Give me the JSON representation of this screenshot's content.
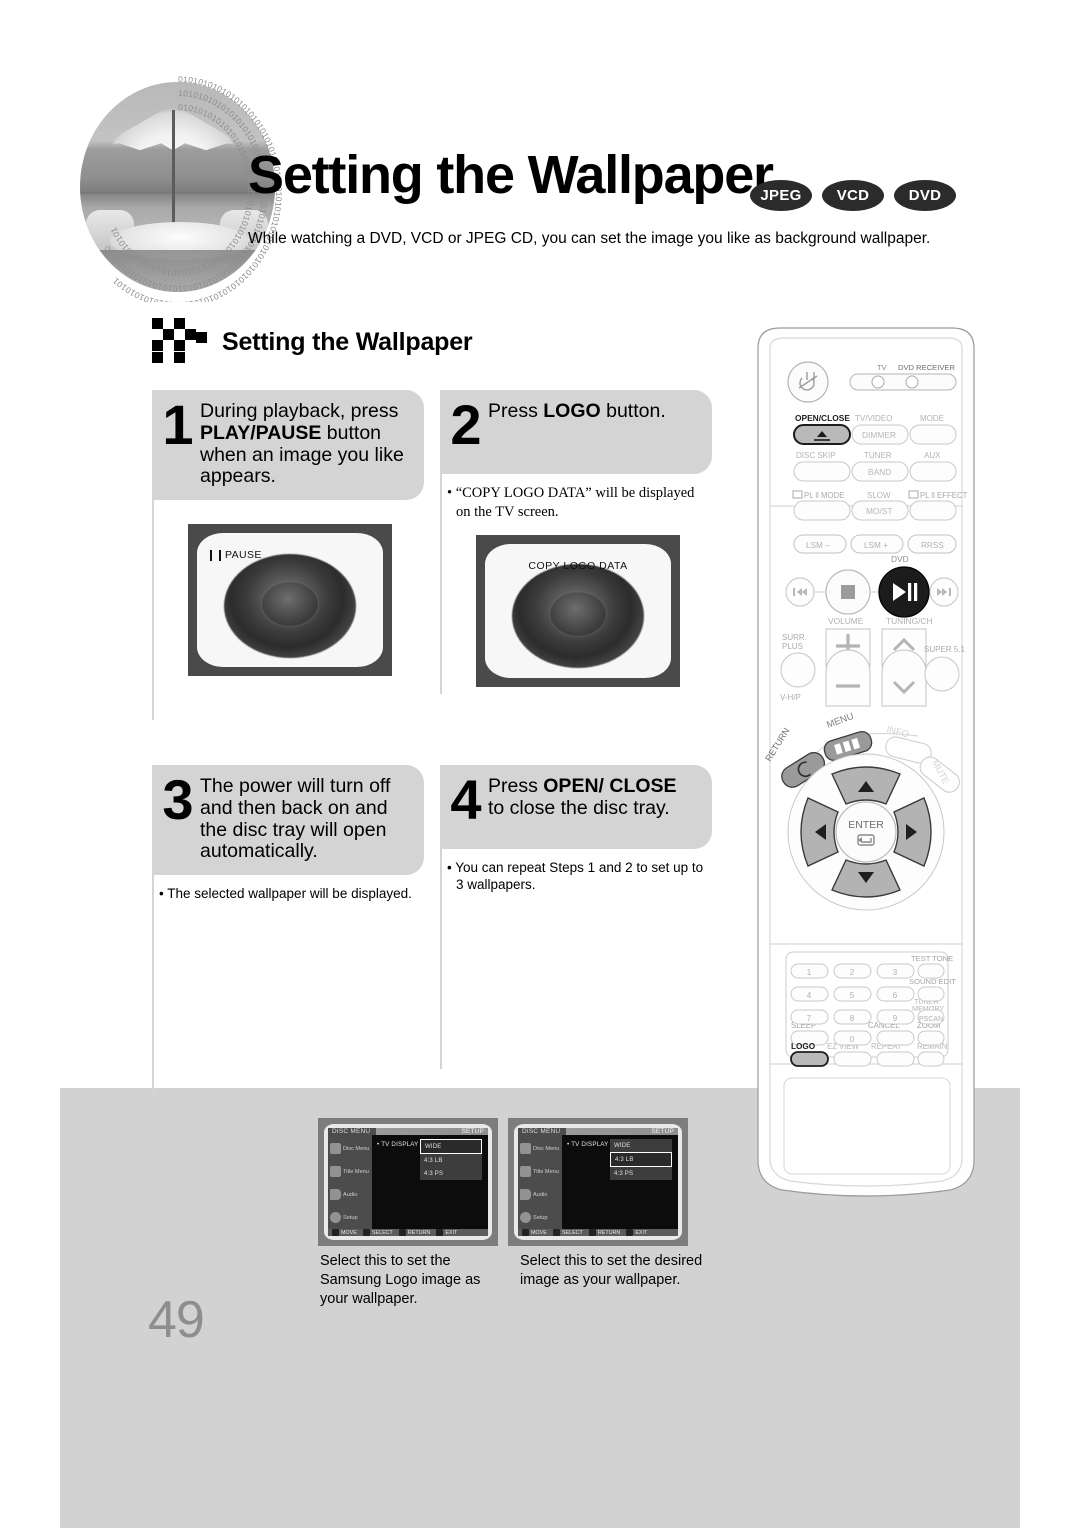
{
  "header": {
    "title": "Setting the Wallpaper",
    "badges": [
      "JPEG",
      "VCD",
      "DVD"
    ],
    "intro": "While watching a DVD, VCD or JPEG CD, you can set the image you like as background wallpaper."
  },
  "section": {
    "heading": "Setting the Wallpaper"
  },
  "steps": [
    {
      "number": "1",
      "text_parts": [
        "During playback, press ",
        "PLAY/PAUSE",
        " button when an image you like appears."
      ],
      "note": "",
      "tv_osd": "PAUSE"
    },
    {
      "number": "2",
      "text_parts": [
        "Press ",
        "LOGO",
        " button."
      ],
      "note": "• “COPY LOGO DATA” will be displayed on the TV screen.",
      "tv_osd": "COPY LOGO DATA"
    },
    {
      "number": "3",
      "text_parts": [
        "The power will turn off and then back on and the disc tray will open automatically.",
        "",
        ""
      ],
      "note": "• The selected wallpaper will be displayed.",
      "tv_osd": ""
    },
    {
      "number": "4",
      "text_parts": [
        "Press ",
        "OPEN/ CLOSE",
        " to close the disc tray."
      ],
      "note": "• You can repeat Steps 1 and 2 to set up to 3 wallpapers.",
      "tv_osd": ""
    }
  ],
  "remote": {
    "labels": {
      "tv": "TV",
      "dvd_receiver": "DVD RECEIVER",
      "open_close": "OPEN/CLOSE",
      "tv_video": "TV/VIDEO",
      "dimmer": "DIMMER",
      "mode": "MODE",
      "disc_skip": "DISC SKIP",
      "tuner": "TUNER",
      "band": "BAND",
      "aux": "AUX",
      "pl2_mode": "PL ll MODE",
      "slow": "SLOW",
      "most": "MO/ST",
      "pl2_effect": "PL ll EFFECT",
      "lsm_minus": "LSM –",
      "lsm_plus": "LSM +",
      "rrss": "RRSS",
      "dvd": "DVD",
      "volume": "VOLUME",
      "tuning_ch": "TUNING/CH",
      "surr_plus": "SURR. PLUS",
      "v_hp": "V-H/P",
      "super51": "SUPER 5.1",
      "menu": "MENU",
      "info": "INFO",
      "return": "RETURN",
      "mute": "MUTE",
      "enter": "ENTER",
      "test_tone": "TEST TONE",
      "sound_edit": "SOUND EDIT",
      "tuner_memory": "TUNER MEMORY",
      "pscan": "PSCAN",
      "sleep": "SLEEP",
      "cancel": "CANCEL",
      "zoom": "ZOOM",
      "logo": "LOGO",
      "ez_view": "EZ VIEW",
      "repeat": "REPEAT",
      "remain": "REMAIN",
      "keys": [
        "1",
        "2",
        "3",
        "4",
        "5",
        "6",
        "7",
        "8",
        "9",
        "0"
      ]
    },
    "highlighted": [
      "OPEN/CLOSE",
      "PLAY/PAUSE",
      "LOGO"
    ]
  },
  "osd_shots": [
    {
      "top_left": "DISC MENU",
      "top_right": "SETUP",
      "sidebar": [
        "Disc Menu",
        "Title Menu",
        "Audio",
        "Setup"
      ],
      "field_label": "TV DISPLAY",
      "options": [
        "WIDE",
        "4:3 LB",
        "4:3 PS"
      ],
      "selected_index": 0,
      "footer_keys": [
        "MOVE",
        "SELECT",
        "RETURN",
        "EXIT"
      ],
      "caption": "Select this to set the Samsung Logo image as your wallpaper."
    },
    {
      "top_left": "DISC MENU",
      "top_right": "SETUP",
      "sidebar": [
        "Disc Menu",
        "Title Menu",
        "Audio",
        "Setup"
      ],
      "field_label": "TV DISPLAY",
      "options": [
        "WIDE",
        "4:3 LB",
        "4:3 PS"
      ],
      "selected_index": 1,
      "footer_keys": [
        "MOVE",
        "SELECT",
        "RETURN",
        "EXIT"
      ],
      "caption": "Select this to set the desired image as your wallpaper."
    }
  ],
  "page_number": "49",
  "colors": {
    "band": "#d2d2d2",
    "bubble": "#d4d4d4",
    "badge": "#2b2b2b",
    "page_num": "#8e8e8e"
  }
}
